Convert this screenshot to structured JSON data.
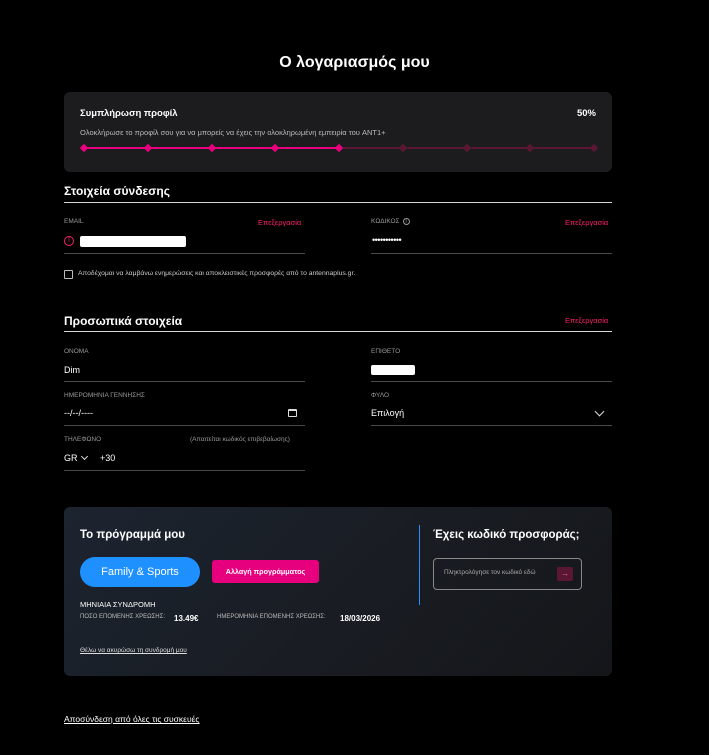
{
  "page_title": "Ο λογαριασμός μου",
  "profile_completion": {
    "title": "Συμπλήρωση προφίλ",
    "percent_text": "50%",
    "progress": 0.5,
    "description": "Ολοκλήρωσε το προφίλ σου για να μπορείς να έχεις την ολοκληρωμένη εμπειρία του ANT1+",
    "steps_total": 9,
    "steps_done": 5
  },
  "login_section": {
    "title": "Στοιχεία σύνδεσης",
    "email_label": "EMAIL",
    "email_edit": "Επεξεργασία",
    "password_label": "ΚΩΔΙΚΟΣ",
    "password_value": "•••••••••••",
    "password_edit": "Επεξεργασία",
    "consent_text": "Αποδέχομαι να λαμβάνω ενημερώσεις και αποκλειστικές προσφορές από το antennaplus.gr."
  },
  "personal_section": {
    "title": "Προσωπικά στοιχεία",
    "edit": "Επεξεργασία",
    "name_label": "ΟΝΟΜΑ",
    "name_value": "Dim",
    "surname_label": "ΕΠΙΘΕΤΟ",
    "birthdate_label": "ΗΜΕΡΟΜΗΝΙΑ ΓΕΝΝΗΣΗΣ",
    "birthdate_value": "--/--/----",
    "gender_label": "ΦΥΛΟ",
    "gender_value": "Επιλογή",
    "phone_label": "ΤΗΛΕΦΩΝΟ",
    "phone_note": "(Απαιτείται κωδικός επιβεβαίωσης)",
    "phone_country": "GR",
    "phone_prefix": "+30"
  },
  "subscription": {
    "title": "Το πρόγραμμά μου",
    "plan_name": "Family & Sports",
    "change_button": "Αλλαγή προγράμματος",
    "type": "ΜΗΝΙΑΙΑ ΣΥΝΔΡΟΜΗ",
    "next_amount_label": "ΠΟΣΟ ΕΠΟΜΕΝΗΣ ΧΡΕΩΣΗΣ:",
    "next_amount_value": "13.49€",
    "next_date_label": "ΗΜΕΡΟΜΗΝΙΑ ΕΠΟΜΕΝΗΣ ΧΡΕΩΣΗΣ:",
    "next_date_value": "18/03/2026",
    "cancel_link": "Θέλω να ακυρώσω τη συνδρομή μου",
    "promo_title": "Έχεις κωδικό προσφοράς;",
    "promo_placeholder": "Πληκτρολόγησε τον κωδικό εδώ",
    "promo_submit_icon": "→"
  },
  "logout_all": "Αποσύνδεση από όλες τις συσκευές",
  "colors": {
    "accent": "#e6007e",
    "link": "#ff1f6a",
    "plan_pill": "#1e90ff",
    "background": "#000000",
    "card": "#1c1c1e"
  }
}
